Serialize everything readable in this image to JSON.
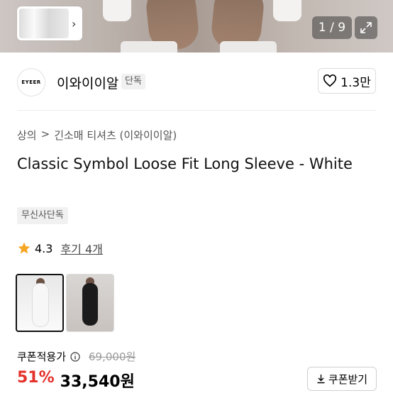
{
  "gallery": {
    "counter": "1 / 9"
  },
  "store": {
    "logo_text": "EYEER",
    "name": "이와이이알",
    "tag": "단독",
    "likes": "1.3만"
  },
  "breadcrumb": {
    "level1": "상의",
    "separator": ">",
    "level2": "긴소매 티셔츠 (이와이이알)"
  },
  "product": {
    "title": "Classic Symbol Loose Fit Long Sleeve - White",
    "exclusive_badge": "무신사단독",
    "rating": "4.3",
    "review_link": "후기 4개"
  },
  "price": {
    "coupon_label": "쿠폰적용가",
    "original": "69,000원",
    "discount": "51%",
    "final": "33,540원",
    "coupon_button": "쿠폰받기"
  },
  "colors": {
    "accent_red": "#e4322b",
    "star": "#f5a623"
  },
  "icons": [
    "chevron-right-icon",
    "expand-icon",
    "heart-icon",
    "star-icon",
    "info-icon",
    "download-icon"
  ]
}
